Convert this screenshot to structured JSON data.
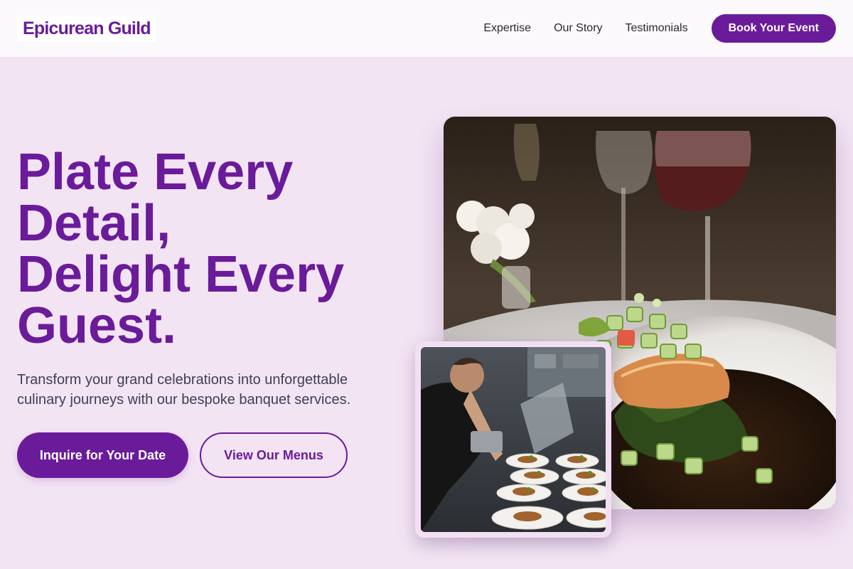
{
  "brand": {
    "name": "Epicurean Guild",
    "accent": "#6a1b9a",
    "background": "#f3e4f4"
  },
  "nav": {
    "links": [
      "Expertise",
      "Our Story",
      "Testimonials"
    ],
    "cta": "Book Your Event"
  },
  "hero": {
    "headline_lines": [
      "Plate Every",
      "Detail,",
      "Delight Every",
      "Guest."
    ],
    "subtext": "Transform your grand celebrations into unforgettable culinary journeys with our bespoke banquet services.",
    "primary_button": "Inquire for Your Date",
    "secondary_button": "View Our Menus"
  },
  "images": {
    "main_alt": "Plated salmon with cucumber salsa and wine glasses",
    "chef_alt": "Chef plating banquet dishes"
  }
}
